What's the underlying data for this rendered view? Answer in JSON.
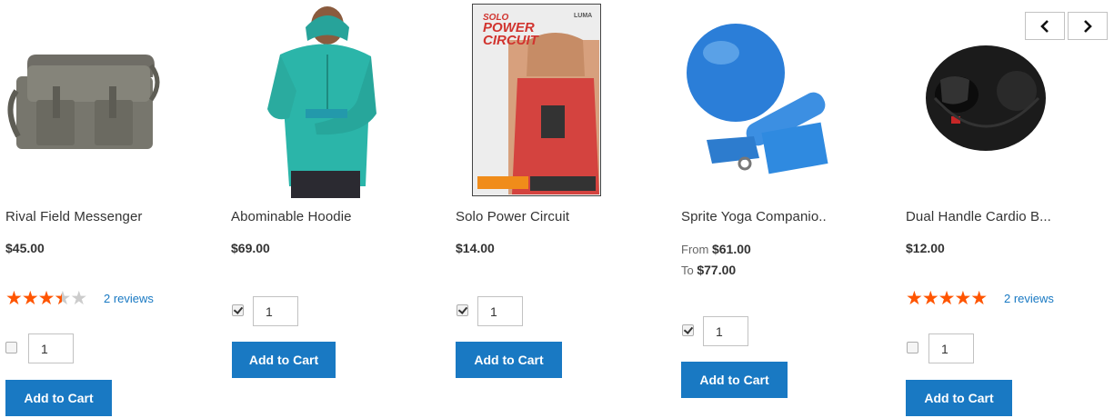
{
  "carousel": {
    "prev_icon": "chevron-left-icon",
    "next_icon": "chevron-right-icon"
  },
  "colors": {
    "accent": "#1979c3",
    "star": "#ff5501",
    "link": "#1979c3"
  },
  "products": [
    {
      "name": "Rival Field Messenger",
      "price": "$45.00",
      "rating": 3.5,
      "reviews": "2 reviews",
      "checked": false,
      "qty": "1",
      "button": "Add to Cart"
    },
    {
      "name": "Abominable Hoodie",
      "price": "$69.00",
      "checked": true,
      "qty": "1",
      "button": "Add to Cart"
    },
    {
      "name": "Solo Power Circuit",
      "price": "$14.00",
      "checked": true,
      "qty": "1",
      "button": "Add to Cart",
      "dvd": {
        "title_1": "SOLO",
        "title_2": "POWER",
        "title_3": "CIRCUIT",
        "brand": "LUMA"
      }
    },
    {
      "name": "Sprite Yoga Companio..",
      "from_label": "From",
      "from_price": "$61.00",
      "to_label": "To",
      "to_price": "$77.00",
      "checked": true,
      "qty": "1",
      "button": "Add to Cart"
    },
    {
      "name": "Dual Handle Cardio B...",
      "price": "$12.00",
      "rating": 5,
      "reviews": "2 reviews",
      "checked": false,
      "qty": "1",
      "button": "Add to Cart"
    }
  ]
}
